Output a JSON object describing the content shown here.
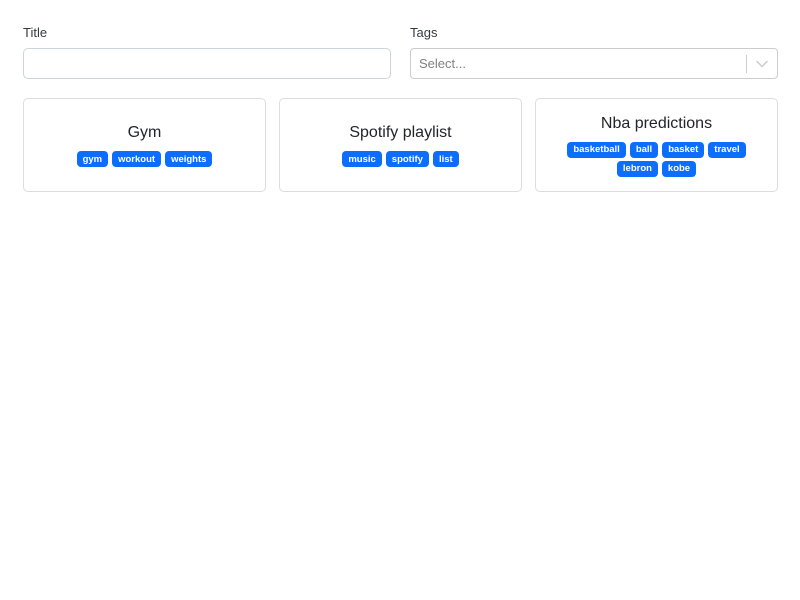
{
  "filters": {
    "title_label": "Title",
    "title_value": "",
    "title_placeholder": "",
    "tags_label": "Tags",
    "tags_placeholder": "Select..."
  },
  "notes": [
    {
      "title": "Gym",
      "tags": [
        "gym",
        "workout",
        "weights"
      ]
    },
    {
      "title": "Spotify playlist",
      "tags": [
        "music",
        "spotify",
        "list"
      ]
    },
    {
      "title": "Nba predictions",
      "tags": [
        "basketball",
        "ball",
        "basket",
        "travel",
        "lebron",
        "kobe"
      ]
    }
  ],
  "colors": {
    "badge": "#0d6efd",
    "border": "#ced4da"
  }
}
